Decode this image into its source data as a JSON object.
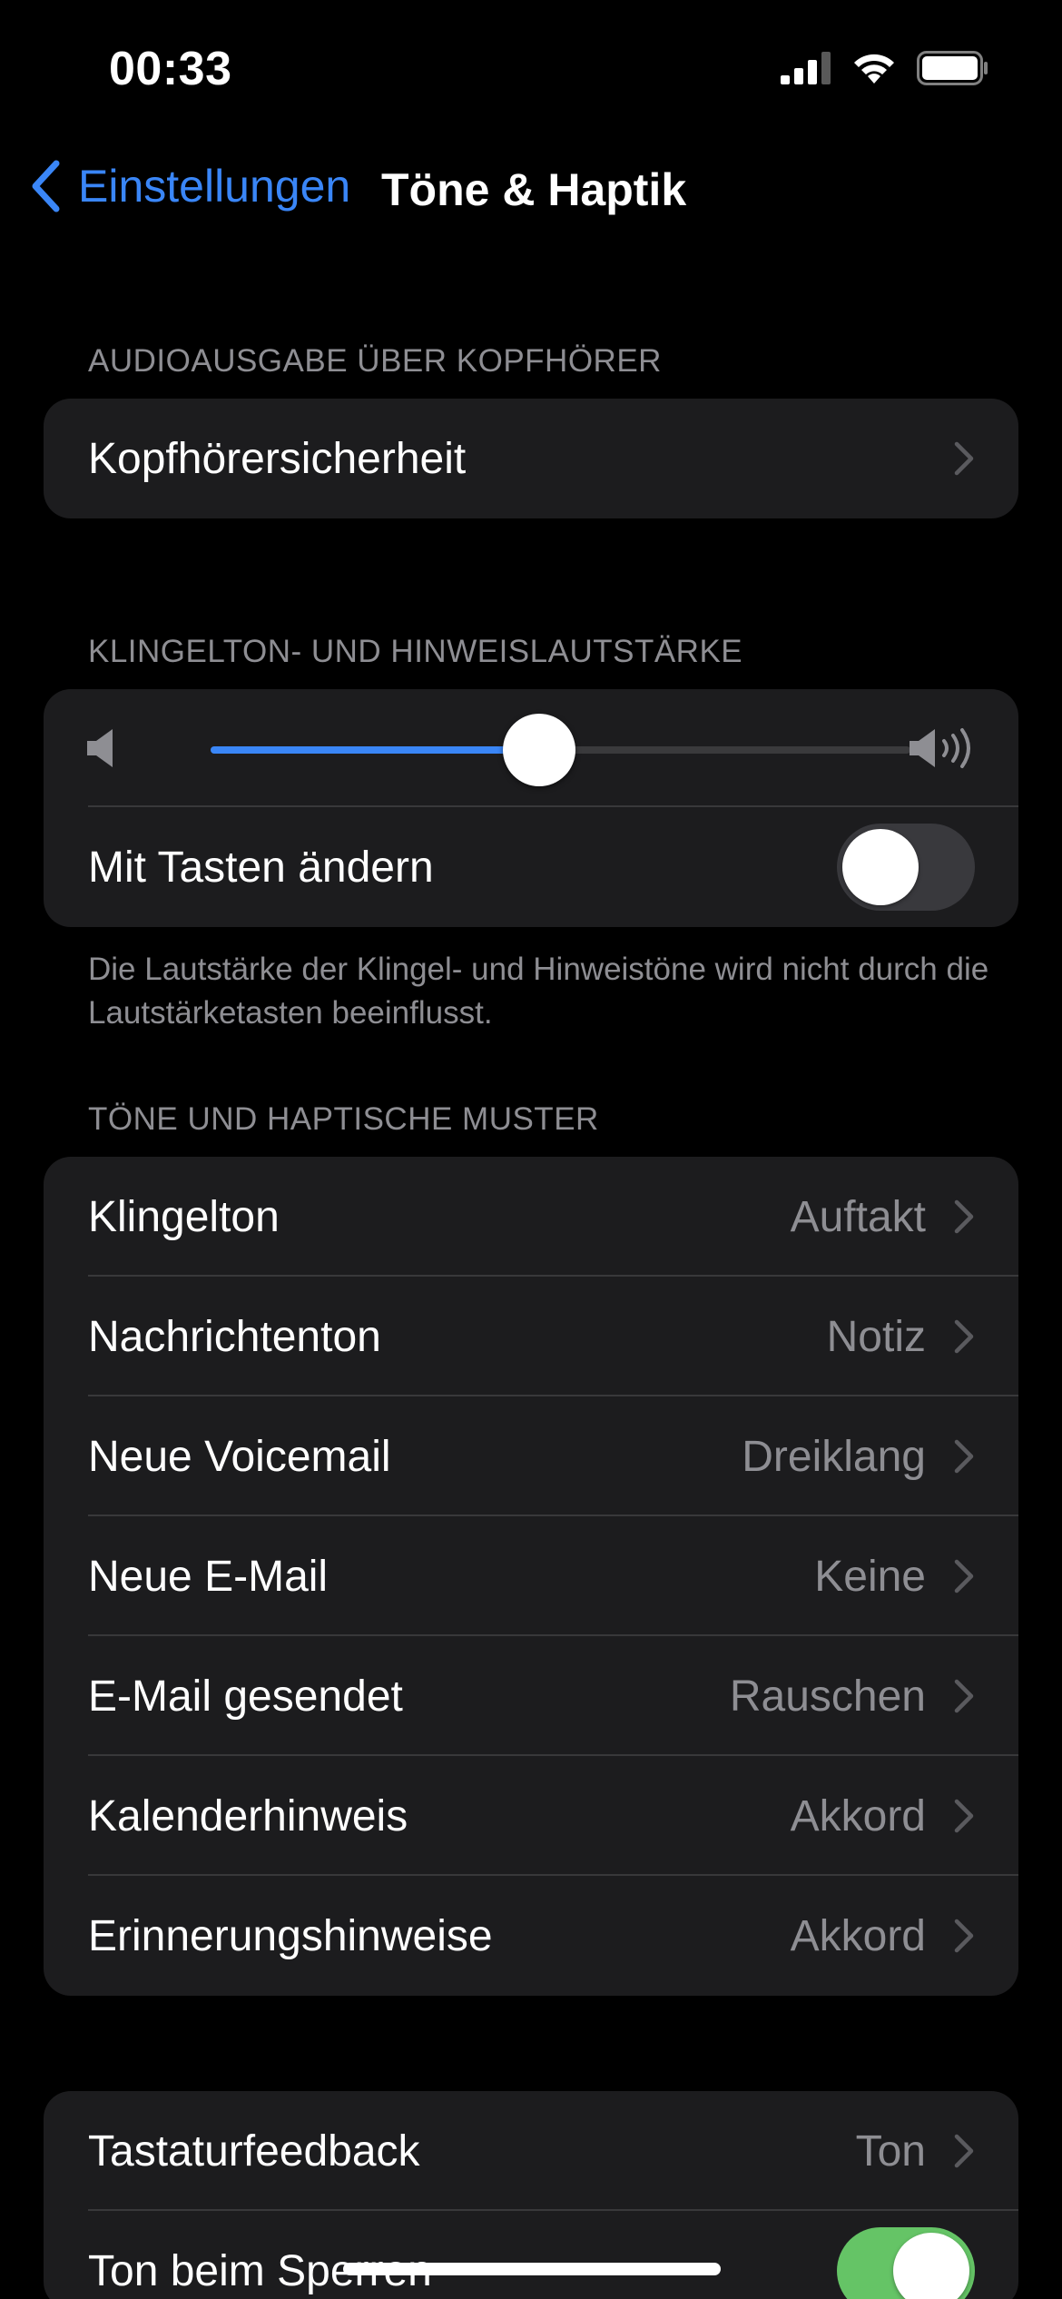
{
  "status_bar": {
    "time": "00:33",
    "battery_level": 1.0
  },
  "nav": {
    "back_label": "Einstellungen",
    "title": "Töne & Haptik"
  },
  "sections": {
    "headphones": {
      "header": "AUDIOAUSGABE ÜBER KOPFHÖRER",
      "row_label": "Kopfhörersicherheit"
    },
    "volume": {
      "header": "KLINGELTON- UND HINWEISLAUTSTÄRKE",
      "level": 0.47,
      "toggle_label": "Mit Tasten ändern",
      "toggle_on": false,
      "footer": "Die Lautstärke der Klingel- und Hinweistöne wird nicht durch die Lautstärketasten beeinflusst."
    },
    "patterns": {
      "header": "TÖNE UND HAPTISCHE MUSTER",
      "rows": [
        {
          "label": "Klingelton",
          "value": "Auftakt"
        },
        {
          "label": "Nachrichtenton",
          "value": "Notiz"
        },
        {
          "label": "Neue Voicemail",
          "value": "Dreiklang"
        },
        {
          "label": "Neue E-Mail",
          "value": "Keine"
        },
        {
          "label": "E-Mail gesendet",
          "value": "Rauschen"
        },
        {
          "label": "Kalenderhinweis",
          "value": "Akkord"
        },
        {
          "label": "Erinnerungshinweise",
          "value": "Akkord"
        }
      ]
    },
    "system": {
      "keyboard_label": "Tastaturfeedback",
      "keyboard_value": "Ton",
      "lock_label": "Ton beim Sperren",
      "lock_on": true
    }
  },
  "colors": {
    "accent": "#3a86f7",
    "toggle_on": "#65c466",
    "group_bg": "#1c1c1e",
    "secondary_text": "#8e8e93"
  }
}
